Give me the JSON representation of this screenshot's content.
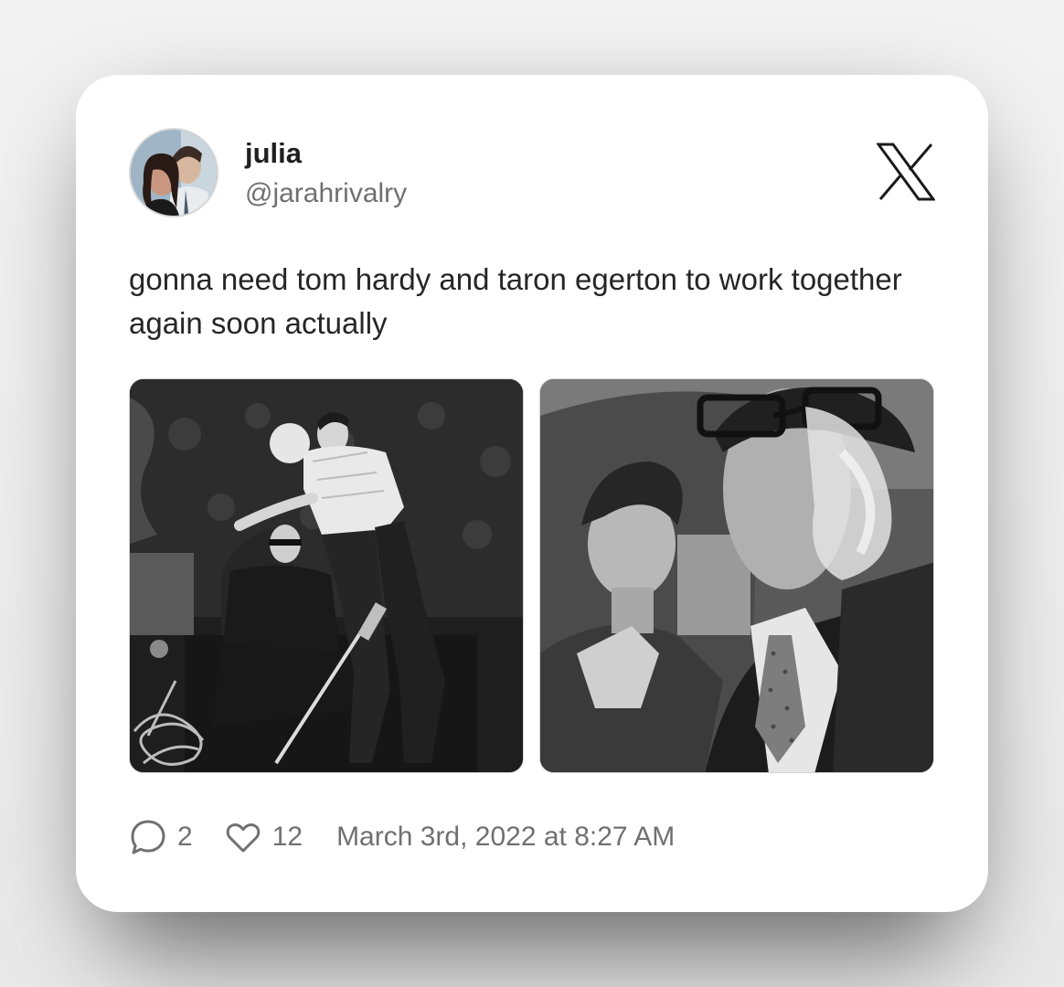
{
  "user": {
    "display_name": "julia",
    "handle": "@jarahrivalry"
  },
  "tweet": {
    "text": "gonna need tom hardy and taron egerton to work together again soon actually",
    "timestamp": "March 3rd, 2022 at 8:27 AM"
  },
  "stats": {
    "replies": "2",
    "likes": "12"
  },
  "icons": {
    "brand": "x-logo-icon",
    "reply": "speech-bubble-icon",
    "like": "heart-icon"
  },
  "media": {
    "count": 2
  },
  "colors": {
    "card_background": "#ffffff",
    "page_background": "#efefef",
    "primary_text": "#262626",
    "secondary_text": "#707070"
  }
}
